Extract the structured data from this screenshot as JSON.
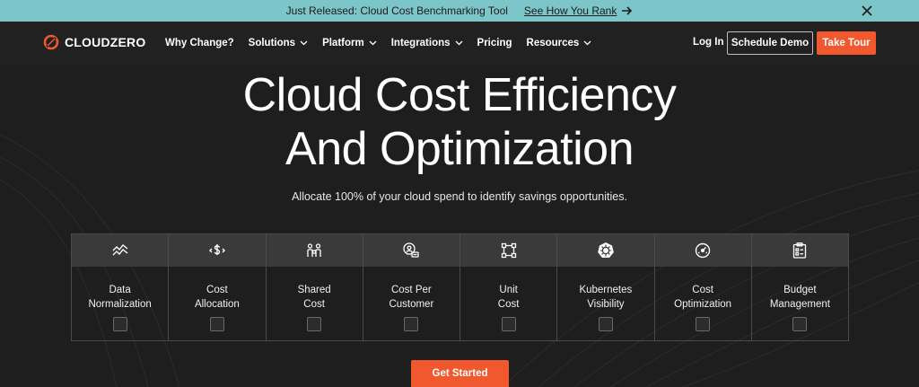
{
  "announcement": {
    "message": "Just Released: Cloud Cost Benchmarking Tool",
    "link_label": "See How You Rank",
    "bg_color": "#7cc5c9"
  },
  "nav": {
    "logo_text": "CLOUDZERO",
    "menu": [
      {
        "label": "Why Change?",
        "dropdown": false
      },
      {
        "label": "Solutions",
        "dropdown": true
      },
      {
        "label": "Platform",
        "dropdown": true
      },
      {
        "label": "Integrations",
        "dropdown": true
      },
      {
        "label": "Pricing",
        "dropdown": false
      },
      {
        "label": "Resources",
        "dropdown": true
      }
    ],
    "login_label": "Log In",
    "demo_label": "Schedule Demo",
    "tour_label": "Take Tour",
    "accent_color": "#f1582d"
  },
  "hero": {
    "title_line1": "Cloud Cost Efficiency",
    "title_line2": "And Optimization",
    "subtitle": "Allocate 100% of your cloud spend to identify savings opportunities."
  },
  "features": [
    {
      "line1": "Data",
      "line2": "Normalization",
      "icon": "trend-lines-icon",
      "checked": false
    },
    {
      "line1": "Cost",
      "line2": "Allocation",
      "icon": "dollar-arrows-icon",
      "checked": false
    },
    {
      "line1": "Shared",
      "line2": "Cost",
      "icon": "people-share-icon",
      "checked": false
    },
    {
      "line1": "Cost Per",
      "line2": "Customer",
      "icon": "customer-card-icon",
      "checked": false
    },
    {
      "line1": "Unit",
      "line2": "Cost",
      "icon": "nodes-square-icon",
      "checked": false
    },
    {
      "line1": "Kubernetes",
      "line2": "Visibility",
      "icon": "kubernetes-icon",
      "checked": false
    },
    {
      "line1": "Cost",
      "line2": "Optimization",
      "icon": "gauge-icon",
      "checked": false
    },
    {
      "line1": "Budget",
      "line2": "Management",
      "icon": "clipboard-icon",
      "checked": false
    }
  ],
  "cta": {
    "label": "Get Started"
  }
}
